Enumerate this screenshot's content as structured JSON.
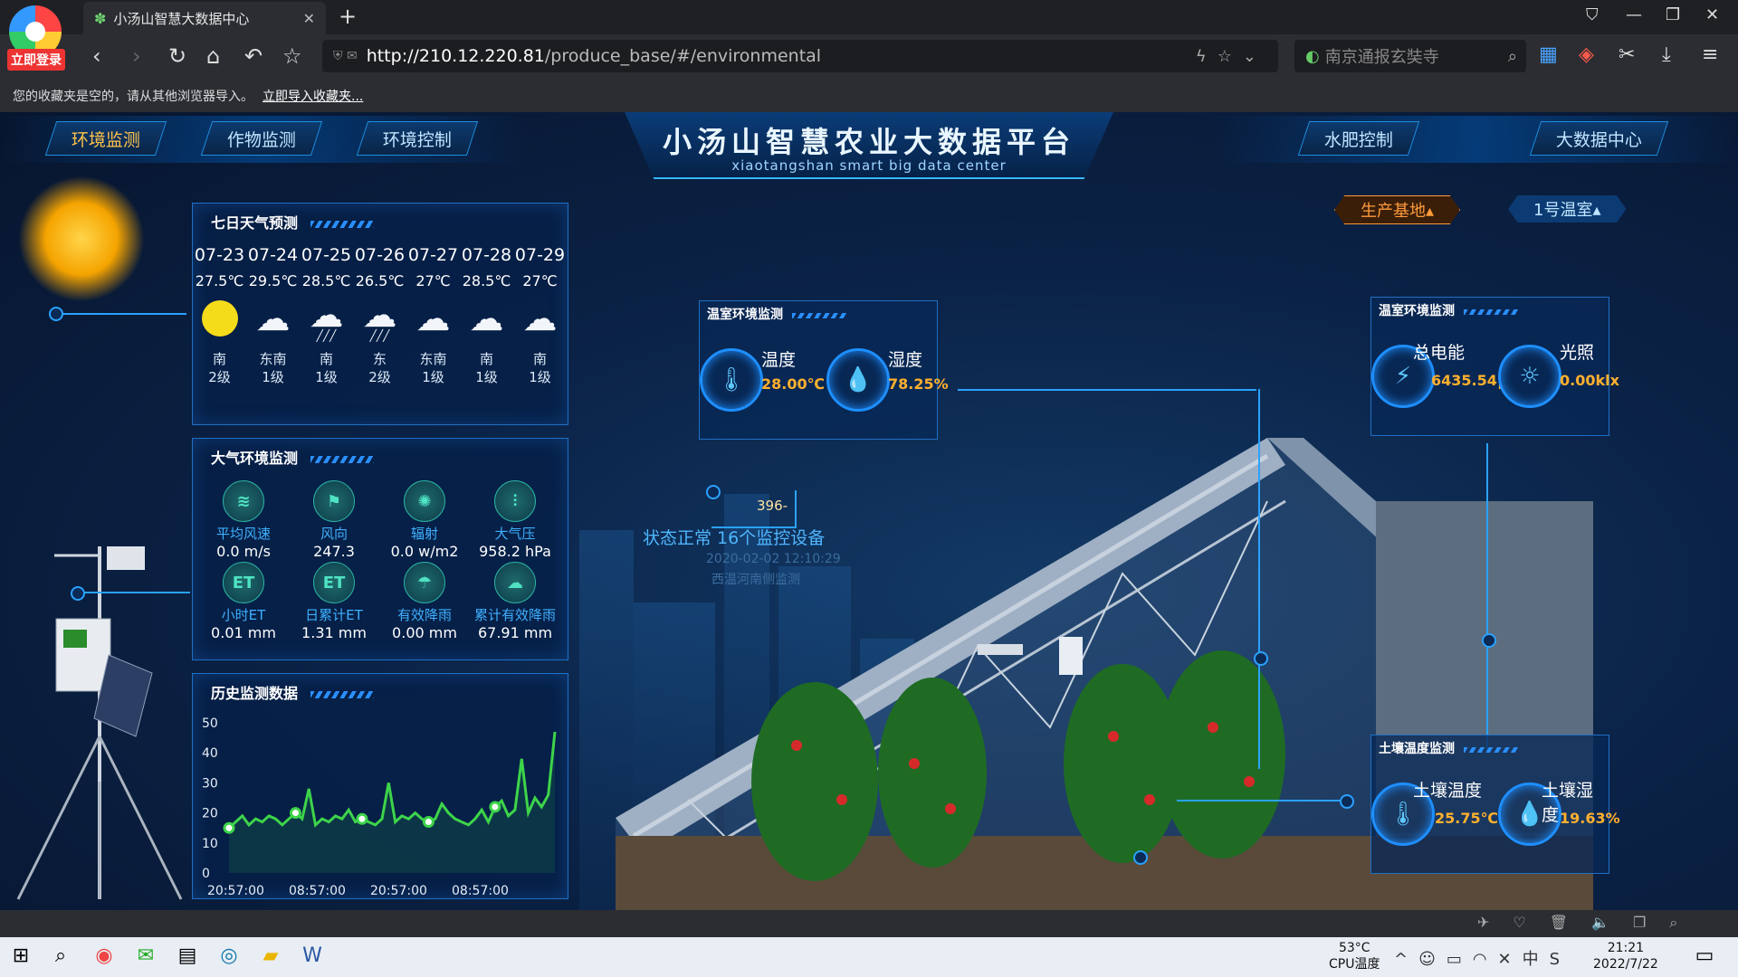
{
  "browser": {
    "tab_title": "小汤山智慧大数据中心",
    "login_badge": "立即登录",
    "url_host": "http://210.12.220.81",
    "url_path": "/produce_base/#/environmental",
    "search_placeholder": "南京通报玄奘寺",
    "bookmarks_text": "您的收藏夹是空的，请从其他浏览器导入。",
    "bookmarks_link": "立即导入收藏夹..."
  },
  "header": {
    "nav_left": [
      "环境监测",
      "作物监测",
      "环境控制"
    ],
    "nav_right": [
      "水肥控制",
      "大数据中心"
    ],
    "title": "小汤山智慧农业大数据平台",
    "subtitle": "xiaotangshan smart big data center",
    "selector_base": "生产基地▴",
    "selector_house": "1号温室▴"
  },
  "weather": {
    "title": "七日天气预测",
    "days": [
      {
        "date": "07-23",
        "temp": "27.5℃",
        "icon": "sun-icon",
        "dir": "南",
        "level": "2级"
      },
      {
        "date": "07-24",
        "temp": "29.5℃",
        "icon": "cloud-icon",
        "dir": "东南",
        "level": "1级"
      },
      {
        "date": "07-25",
        "temp": "28.5℃",
        "icon": "rain-icon",
        "dir": "南",
        "level": "1级"
      },
      {
        "date": "07-26",
        "temp": "26.5℃",
        "icon": "rain-icon",
        "dir": "东",
        "level": "2级"
      },
      {
        "date": "07-27",
        "temp": "27℃",
        "icon": "cloud-icon",
        "dir": "东南",
        "level": "1级"
      },
      {
        "date": "07-28",
        "temp": "28.5℃",
        "icon": "cloud-icon",
        "dir": "南",
        "level": "1级"
      },
      {
        "date": "07-29",
        "temp": "27℃",
        "icon": "cloud-icon",
        "dir": "南",
        "level": "1级"
      }
    ]
  },
  "atmosphere": {
    "title": "大气环境监测",
    "items": [
      {
        "label": "平均风速",
        "value": "0.0 m/s",
        "icon": "wind-speed-icon",
        "glyph": "≋"
      },
      {
        "label": "风向",
        "value": "247.3",
        "icon": "wind-direction-icon",
        "glyph": "⚑"
      },
      {
        "label": "辐射",
        "value": "0.0 w/m2",
        "icon": "radiation-icon",
        "glyph": "✺"
      },
      {
        "label": "大气压",
        "value": "958.2 hPa",
        "icon": "pressure-icon",
        "glyph": "⫶"
      },
      {
        "label": "小时ET",
        "value": "0.01 mm",
        "icon": "et-hour-icon",
        "glyph": "ET"
      },
      {
        "label": "日累计ET",
        "value": "1.31 mm",
        "icon": "et-day-icon",
        "glyph": "ET"
      },
      {
        "label": "有效降雨",
        "value": "0.00 mm",
        "icon": "rain-effective-icon",
        "glyph": "☂"
      },
      {
        "label": "累计有效降雨",
        "value": "67.91 mm",
        "icon": "rain-total-icon",
        "glyph": "☁"
      }
    ]
  },
  "history": {
    "title": "历史监测数据"
  },
  "chart_data": {
    "type": "line",
    "title": "历史监测数据",
    "x_ticks": [
      "20:57:00",
      "08:57:00",
      "20:57:00",
      "08:57:00"
    ],
    "ylim": [
      0,
      50
    ],
    "y_ticks": [
      0,
      10,
      20,
      30,
      40,
      50
    ],
    "values": [
      15,
      17,
      19,
      16,
      18,
      17,
      19,
      18,
      16,
      18,
      20,
      18,
      28,
      16,
      18,
      17,
      19,
      18,
      21,
      17,
      18,
      17,
      16,
      18,
      30,
      17,
      19,
      18,
      20,
      18,
      17,
      18,
      23,
      20,
      18,
      17,
      16,
      18,
      21,
      17,
      22,
      24,
      19,
      21,
      38,
      20,
      25,
      22,
      26,
      47
    ],
    "grid": false,
    "color": "#3dd44a"
  },
  "greenhouse_env": {
    "title": "温室环境监测",
    "temp_label": "温度",
    "temp_value": "28.00℃",
    "hum_label": "湿度",
    "hum_value": "78.25%"
  },
  "power_env": {
    "title": "温室环境监测",
    "power_label": "总电能",
    "power_value": "6435.54|",
    "light_label": "光照",
    "light_value": "0.00klx"
  },
  "soil": {
    "title": "土壤温度监测",
    "temp_label": "土壤温度",
    "temp_value": "25.75℃",
    "hum_label": "土壤湿度",
    "hum_value": "19.63%"
  },
  "device": {
    "count": "396-",
    "status": "状态正常  16个监控设备",
    "time": "2020-02-02 12:10:29",
    "location": "西温河南侧监测"
  },
  "taskbar": {
    "temp": "53°C",
    "temp_label": "CPU温度",
    "time": "21:21",
    "date": "2022/7/22"
  }
}
